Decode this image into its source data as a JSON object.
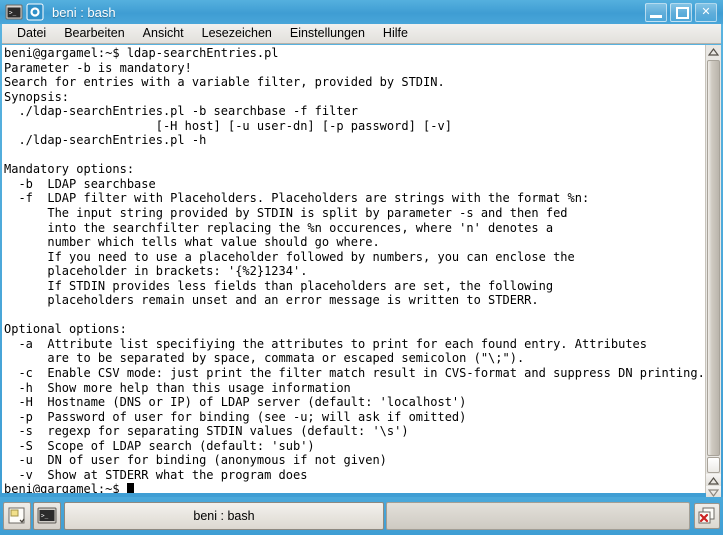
{
  "window": {
    "title": "beni : bash",
    "icons": {
      "app": "terminal-icon",
      "sticky": "on-all-desktops-icon"
    },
    "controls": {
      "minimize": "minimize-icon",
      "maximize": "maximize-icon",
      "close": "close-icon"
    }
  },
  "menubar": {
    "items": [
      {
        "label": "Datei"
      },
      {
        "label": "Bearbeiten"
      },
      {
        "label": "Ansicht"
      },
      {
        "label": "Lesezeichen"
      },
      {
        "label": "Einstellungen"
      },
      {
        "label": "Hilfe"
      }
    ]
  },
  "terminal": {
    "prompt": "beni@gargamel:~$ ",
    "command": "ldap-searchEntries.pl",
    "output": "beni@gargamel:~$ ldap-searchEntries.pl\nParameter -b is mandatory!\nSearch for entries with a variable filter, provided by STDIN.\nSynopsis:\n  ./ldap-searchEntries.pl -b searchbase -f filter\n                     [-H host] [-u user-dn] [-p password] [-v]\n  ./ldap-searchEntries.pl -h\n\nMandatory options:\n  -b  LDAP searchbase\n  -f  LDAP filter with Placeholders. Placeholders are strings with the format %n:\n      The input string provided by STDIN is split by parameter -s and then fed\n      into the searchfilter replacing the %n occurences, where 'n' denotes a\n      number which tells what value should go where.\n      If you need to use a placeholder followed by numbers, you can enclose the\n      placeholder in brackets: '{%2}1234'.\n      If STDIN provides less fields than placeholders are set, the following\n      placeholders remain unset and an error message is written to STDERR.\n\nOptional options:\n  -a  Attribute list specifiying the attributes to print for each found entry. Attributes\n      are to be separated by space, commata or escaped semicolon (\"\\;\").\n  -c  Enable CSV mode: just print the filter match result in CVS-format and suppress DN printing.\n  -h  Show more help than this usage information\n  -H  Hostname (DNS or IP) of LDAP server (default: 'localhost')\n  -p  Password of user for binding (see -u; will ask if omitted)\n  -s  regexp for separating STDIN values (default: '\\s')\n  -S  Scope of LDAP search (default: 'sub')\n  -u  DN of user for binding (anonymous if not given)\n  -v  Show at STDERR what the program does\n",
    "last_prompt": "beni@gargamel:~$ ",
    "background": "#ffffff",
    "foreground": "#000000"
  },
  "scrollbar": {
    "up_arrow": "scroll-up-icon",
    "down_arrow": "scroll-down-icon"
  },
  "taskbar": {
    "pager_icon": "desktop-pager-icon",
    "task_icon": "terminal-icon",
    "task_label": "beni : bash",
    "close_icon": "close-window-icon"
  },
  "colors": {
    "titlebar": "#3f9ed4",
    "titlebar_light": "#55b0de",
    "menubar": "#e9e7e3",
    "terminal_bg": "#ffffff",
    "taskbar": "#45a3d7",
    "desktop": "#b8b4ac"
  }
}
